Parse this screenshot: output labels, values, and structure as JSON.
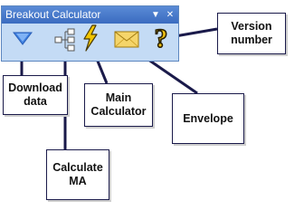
{
  "toolbar": {
    "title": "Breakout Calculator",
    "dropdown_glyph": "▼",
    "close_glyph": "✕",
    "icons": [
      "down-arrow-icon",
      "calculate-ma-icon",
      "lightning-icon",
      "envelope-icon",
      "help-question-icon"
    ]
  },
  "callouts": {
    "download": "Download\ndata",
    "calculate": "Calculate\nMA",
    "main": "Main\nCalculator",
    "envelope": "Envelope",
    "version": "Version\nnumber"
  },
  "colors": {
    "toolbar_bg": "#c4dbf5",
    "titlebar": "#4a7bcb",
    "arrow_icon": "#3d7fe0",
    "lightning": "#f2c500",
    "envelope": "#f5d56a",
    "question": "#f0c010",
    "callout_line": "#1a1a4a"
  }
}
